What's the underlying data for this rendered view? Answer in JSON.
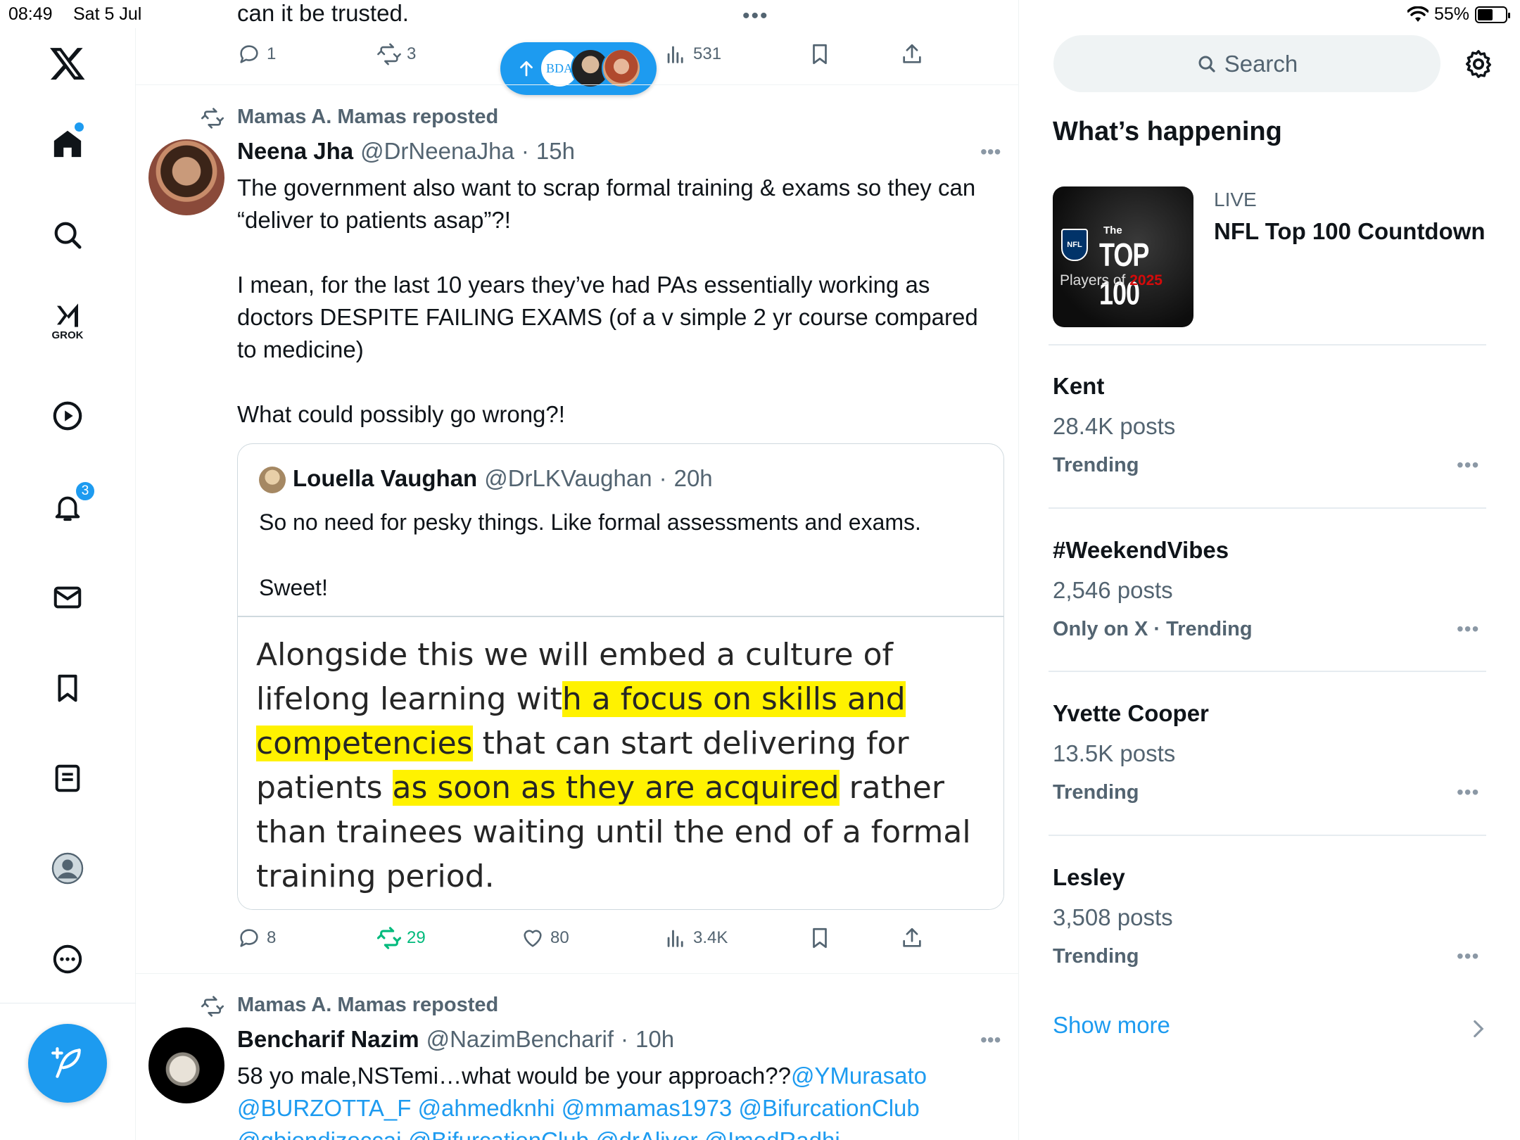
{
  "status_bar": {
    "time": "08:49",
    "date": "Sat 5 Jul",
    "battery": "55%",
    "battery_level": 0.55
  },
  "nav": {
    "notifications_badge": "3",
    "grok_label": "GROK"
  },
  "pill": {
    "logo_text": "BDA"
  },
  "previous_tweet": {
    "text_tail": "can it be trusted.",
    "replies": "1",
    "reposts": "3",
    "views": "531"
  },
  "tweet1": {
    "repost_label": "Mamas A. Mamas reposted",
    "name": "Neena Jha",
    "handle": "@DrNeenaJha",
    "dot": "·",
    "time": "15h",
    "body": [
      "The government also want to scrap formal training & exams so they can",
      "“deliver to patients asap”?!",
      "",
      "I mean, for the last 10 years they’ve had PAs essentially working as",
      "doctors DESPITE FAILING EXAMS (of a v simple 2 yr course compared",
      "to medicine)",
      "",
      "What could possibly go wrong?!"
    ],
    "quote": {
      "name": "Louella Vaughan",
      "handle": "@DrLKVaughan",
      "dot": "·",
      "time": "20h",
      "text1": "So no need for pesky things. Like formal assessments and exams.",
      "text2": "Sweet!",
      "image_lines": [
        [
          "Alongside this we will embed a culture of"
        ],
        [
          "lifelong learning wit",
          "h a focus on skills and"
        ],
        [
          "competencies",
          " that can start delivering for"
        ],
        [
          "patients ",
          "as soon as they are acquired",
          " rather"
        ],
        [
          "than trainees waiting until the end of a formal"
        ],
        [
          "training period."
        ]
      ]
    },
    "replies": "8",
    "reposts": "29",
    "likes": "80",
    "views": "3.4K"
  },
  "tweet2": {
    "repost_label": "Mamas A. Mamas reposted",
    "name": "Bencharif Nazim",
    "handle": "@NazimBencharif",
    "dot": "·",
    "time": "10h",
    "line1_text": "58 yo male,NSTemi…what would be your approach??",
    "line1_link": "@YMurasato",
    "line2_links": [
      "@BURZOTTA_F",
      "@ahmedknhi",
      "@mmamas1973",
      "@BifurcationClub"
    ],
    "line3_partial": "@gbiondizoccai @BifurcationClub @drAlivor @ImedRadhi"
  },
  "search": {
    "placeholder": "Search"
  },
  "trends": {
    "heading": "What’s happening",
    "live": {
      "label": "LIVE",
      "title": "NFL Top 100 Countdown",
      "image_text_the": "The",
      "image_text_top": "TOP 100",
      "image_text_players": "Players of",
      "image_text_year": "2025",
      "image_text_nfl": "NFL"
    },
    "items": [
      {
        "title": "Kent",
        "posts": "28.4K posts",
        "meta": "Trending"
      },
      {
        "title": "#WeekendVibes",
        "posts": "2,546 posts",
        "meta": "Only on X · Trending"
      },
      {
        "title": "Yvette Cooper",
        "posts": "13.5K posts",
        "meta": "Trending"
      },
      {
        "title": "Lesley",
        "posts": "3,508 posts",
        "meta": "Trending"
      }
    ],
    "show_more": "Show more"
  },
  "colors": {
    "accent": "#1d9bf0",
    "repost_green": "#00ba7c",
    "highlight": "#fff200",
    "muted": "#536471"
  }
}
